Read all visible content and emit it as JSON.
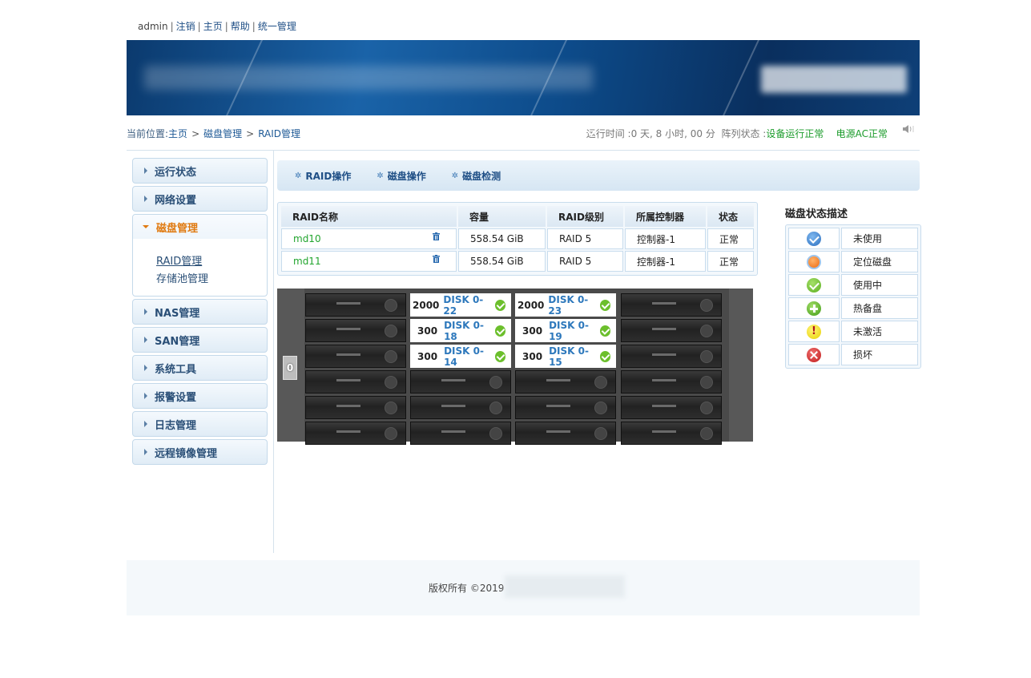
{
  "top_links": {
    "user": "admin",
    "logout": "注销",
    "home": "主页",
    "help": "帮助",
    "unified": "统一管理"
  },
  "breadcrumb": {
    "prefix": "当前位置:",
    "items": [
      "主页",
      "磁盘管理",
      "RAID管理"
    ]
  },
  "status": {
    "uptime_label": "运行时间 :",
    "uptime_value": "0 天,  8 小时,  00 分",
    "array_label": "阵列状态 :",
    "array_value": "设备运行正常",
    "power_value": "电源AC正常"
  },
  "sidebar": {
    "items_top": [
      "运行状态",
      "网络设置"
    ],
    "open_item": {
      "label": "磁盘管理",
      "subitems": [
        "RAID管理",
        "存储池管理"
      ]
    },
    "items_bottom": [
      "NAS管理",
      "SAN管理",
      "系统工具",
      "报警设置",
      "日志管理",
      "远程镜像管理"
    ]
  },
  "tabs": [
    "RAID操作",
    "磁盘操作",
    "磁盘检测"
  ],
  "raid_table": {
    "headers": [
      "RAID名称",
      "容量",
      "RAID级别",
      "所属控制器",
      "状态"
    ],
    "rows": [
      {
        "name": "md10",
        "capacity": "558.54 GiB",
        "level": "RAID 5",
        "controller": "控制器-1",
        "status": "正常"
      },
      {
        "name": "md11",
        "capacity": "558.54 GiB",
        "level": "RAID 5",
        "controller": "控制器-1",
        "status": "正常"
      }
    ]
  },
  "chassis": {
    "id": "0",
    "disks": [
      {
        "size": "2000",
        "name": "DISK 0-22"
      },
      {
        "size": "2000",
        "name": "DISK 0-23"
      },
      {
        "size": "300",
        "name": "DISK 0-18"
      },
      {
        "size": "300",
        "name": "DISK 0-19"
      },
      {
        "size": "300",
        "name": "DISK 0-14"
      },
      {
        "size": "300",
        "name": "DISK 0-15"
      }
    ]
  },
  "legend": {
    "title": "磁盘状态描述",
    "items": [
      {
        "icon": "unused-icon",
        "label": "未使用"
      },
      {
        "icon": "locate-disk-icon",
        "label": "定位磁盘"
      },
      {
        "icon": "in-use-icon",
        "label": "使用中"
      },
      {
        "icon": "hot-spare-icon",
        "label": "热备盘"
      },
      {
        "icon": "inactive-icon",
        "label": "未激活"
      },
      {
        "icon": "broken-icon",
        "label": "损坏"
      }
    ]
  },
  "footer": {
    "copyright": "版权所有 ©2019"
  }
}
